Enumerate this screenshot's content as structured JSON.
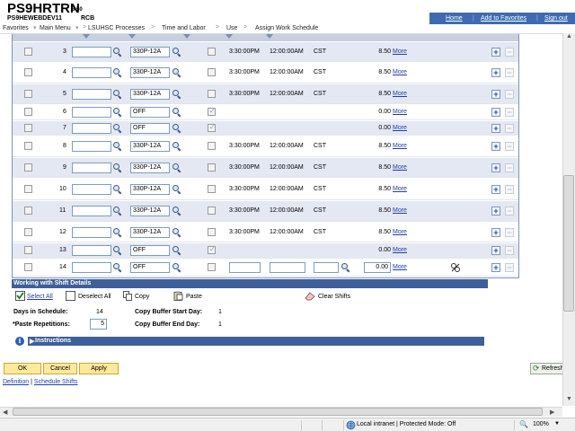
{
  "header": {
    "app_title": "PS9HRTRN",
    "app_version": "8.50",
    "db_name": "PS9HEWEBDEV11",
    "db_suffix": "RCB"
  },
  "topnav": {
    "home": "Home",
    "add_to_favorites": "Add to Favorites",
    "sign_out": "Sign out"
  },
  "breadcrumb": [
    "Favorites",
    "Main Menu",
    "LSUHSC Processes",
    "Time and Labor",
    "Use",
    "Assign Work Schedule"
  ],
  "grid": {
    "more_label": "More",
    "rows": [
      {
        "day": "3",
        "shift": "330P-12A",
        "checked": false,
        "start": "3:30:00PM",
        "end": "12:00:00AM",
        "tz": "CST",
        "hours": "8.50"
      },
      {
        "day": "4",
        "shift": "330P-12A",
        "checked": false,
        "start": "3:30:00PM",
        "end": "12:00:00AM",
        "tz": "CST",
        "hours": "8.50"
      },
      {
        "day": "5",
        "shift": "330P-12A",
        "checked": false,
        "start": "3:30:00PM",
        "end": "12:00:00AM",
        "tz": "CST",
        "hours": "8.50"
      },
      {
        "day": "6",
        "shift": "OFF",
        "checked": true,
        "start": "",
        "end": "",
        "tz": "",
        "hours": "0.00"
      },
      {
        "day": "7",
        "shift": "OFF",
        "checked": true,
        "start": "",
        "end": "",
        "tz": "",
        "hours": "0.00"
      },
      {
        "day": "8",
        "shift": "330P-12A",
        "checked": false,
        "start": "3:30:00PM",
        "end": "12:00:00AM",
        "tz": "CST",
        "hours": "8.50"
      },
      {
        "day": "9",
        "shift": "330P-12A",
        "checked": false,
        "start": "3:30:00PM",
        "end": "12:00:00AM",
        "tz": "CST",
        "hours": "8.50"
      },
      {
        "day": "10",
        "shift": "330P-12A",
        "checked": false,
        "start": "3:30:00PM",
        "end": "12:00:00AM",
        "tz": "CST",
        "hours": "8.50"
      },
      {
        "day": "11",
        "shift": "330P-12A",
        "checked": false,
        "start": "3:30:00PM",
        "end": "12:00:00AM",
        "tz": "CST",
        "hours": "8.50"
      },
      {
        "day": "12",
        "shift": "330P-12A",
        "checked": false,
        "start": "3:30:00PM",
        "end": "12:00:00AM",
        "tz": "CST",
        "hours": "8.50"
      },
      {
        "day": "13",
        "shift": "OFF",
        "checked": true,
        "start": "",
        "end": "",
        "tz": "",
        "hours": "0.00"
      }
    ],
    "edit_row": {
      "day": "14",
      "shift": "OFF",
      "hours": "0.00"
    }
  },
  "shift_details": {
    "title": "Working with Shift Details",
    "select_all": "Select All",
    "deselect_all": "Deselect All",
    "copy": "Copy",
    "paste": "Paste",
    "clear_shifts": "Clear Shifts",
    "days_in_schedule_label": "Days in Schedule:",
    "days_in_schedule_value": "14",
    "paste_repetitions_label": "*Paste Repetitions:",
    "paste_repetitions_value": "5",
    "copy_buffer_start_label": "Copy Buffer Start Day:",
    "copy_buffer_start_value": "1",
    "copy_buffer_end_label": "Copy Buffer End Day:",
    "copy_buffer_end_value": "1"
  },
  "instructions": {
    "title": "Instructions"
  },
  "buttons": {
    "ok": "OK",
    "cancel": "Cancel",
    "apply": "Apply",
    "refresh": "Refresh"
  },
  "bottom_links": {
    "definition": "Definition",
    "separator": " | ",
    "schedule_shifts": "Schedule Shifts"
  },
  "statusbar": {
    "zone": "Local intranet | Protected Mode: Off",
    "zoom": "100%"
  },
  "colors": {
    "nav_blue": "#3e6bb0",
    "section_bar": "#3e5f9a",
    "row_shade": "#e3e8f3",
    "button_yellow": "#ffe99a"
  }
}
